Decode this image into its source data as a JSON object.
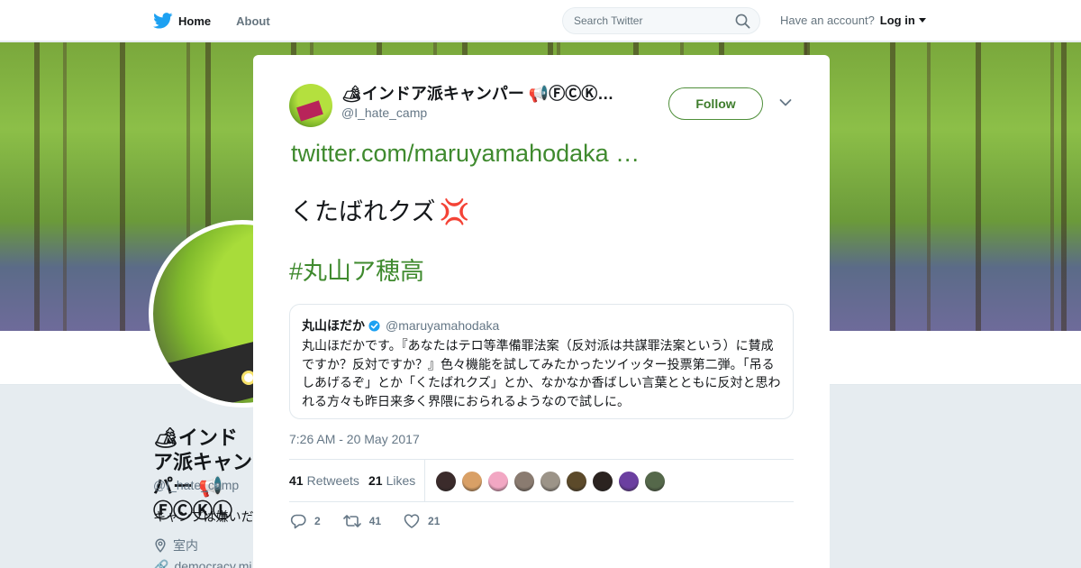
{
  "nav": {
    "home_label": "Home",
    "about_label": "About",
    "search_placeholder": "Search Twitter",
    "account_prompt": "Have an account?",
    "login_label": "Log in"
  },
  "profile": {
    "name": "🏕インドア派キャンパー 📢ⒻⒸⓀⓁ",
    "handle": "@I_hate_camp",
    "bio": "キャンプは嫌いだ",
    "location": "室内",
    "link": "democracy.mi"
  },
  "tweet": {
    "author_name": "🏕インドア派キャンパー 📢ⒻⒸⓀ…",
    "author_handle": "@I_hate_camp",
    "follow_label": "Follow",
    "link_text": "twitter.com/maruyamahodaka …",
    "text": "くたばれクズ",
    "text_emoji": "💢",
    "hashtag": "#丸山ア穂高",
    "timestamp": "7:26 AM - 20 May 2017",
    "retweets_count": "41",
    "retweets_label": "Retweets",
    "likes_count": "21",
    "likes_label": "Likes",
    "reply_count": "2",
    "retweet_action_count": "41",
    "like_action_count": "21",
    "liker_colors": [
      "#3b2b2b",
      "#d9a066",
      "#f2a7c3",
      "#8a7b70",
      "#9c9488",
      "#5c4a2a",
      "#2b2320",
      "#6b3fa0",
      "#55684a"
    ]
  },
  "quote": {
    "name": "丸山ほだか",
    "verified": true,
    "handle": "@maruyamahodaka",
    "text": "丸山ほだかです。『あなたはテロ等準備罪法案（反対派は共謀罪法案という）に賛成ですか？反対ですか？』色々機能を試してみたかったツイッター投票第二弾。「吊るしあげるぞ」とか「くたばれクズ」とか、なかなか香ばしい言葉とともに反対と思われる方々も昨日来多く界隈におられるようなので試しに。"
  },
  "colors": {
    "accent_green": "#3f8a2e",
    "secondary_text": "#657786"
  }
}
